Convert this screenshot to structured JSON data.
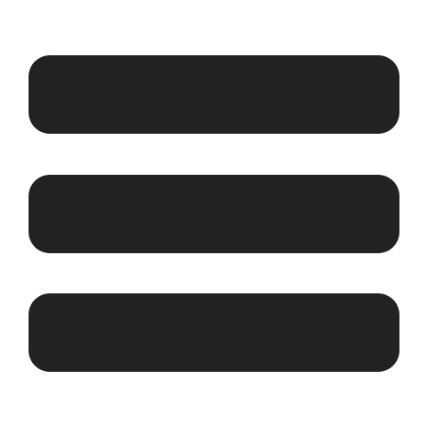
{
  "icon": {
    "name": "hamburger-menu-icon",
    "bar_count": 3,
    "colors": {
      "bar": "#222222",
      "background": "#ffffff"
    }
  }
}
